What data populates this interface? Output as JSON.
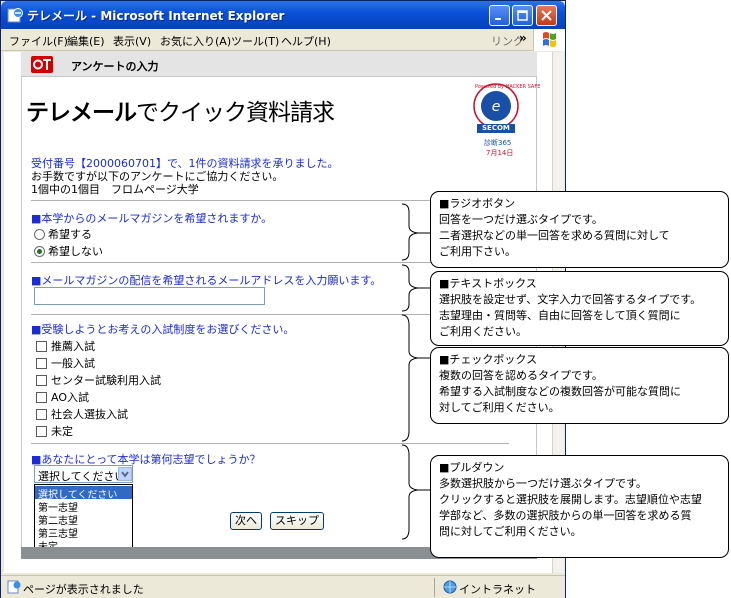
{
  "window": {
    "title": "テレメール - Microsoft Internet Explorer",
    "menu": [
      "ファイル(F)",
      "編集(E)",
      "表示(V)",
      "お気に入り(A)",
      "ツール(T)",
      "ヘルプ(H)"
    ],
    "links_label": "リンク",
    "links_chevron": "»",
    "status_text": "ページが表示されました",
    "zone_text": "イントラネット"
  },
  "page": {
    "header_title": "アンケートの入力",
    "brand_bold": "テレメール",
    "brand_rest": "でクイック資料請求",
    "seal": {
      "top_text": "Powered by HACKER SAFE",
      "middle_text": "SECOM",
      "bottom_text": "診断365",
      "date_text": "7月14日"
    },
    "intro_line1": "受付番号【2000060701】で、1件の資料請求を承りました。",
    "intro_line2": "お手数ですが以下のアンケートにご協力ください。",
    "intro_line3": "1個中の1個目　フロムページ大学",
    "q1": {
      "label": "■本学からのメールマガジンを希望されますか。",
      "options": [
        "希望する",
        "希望しない"
      ],
      "selected_index": 1
    },
    "q2": {
      "label": "■メールマガジンの配信を希望されるメールアドレスを入力願います。",
      "value": ""
    },
    "q3": {
      "label": "■受験しようとお考えの入試制度をお選びください。",
      "options": [
        "推薦入試",
        "一般入試",
        "センター試験利用入試",
        "AO入試",
        "社会人選抜入試",
        "未定"
      ]
    },
    "q4": {
      "label": "■あなたにとって本学は第何志望でしょうか？",
      "selected": "選択してください",
      "options": [
        "選択してください",
        "第一志望",
        "第二志望",
        "第三志望",
        "未定"
      ]
    },
    "buttons": {
      "next": "次へ",
      "skip": "スキップ"
    }
  },
  "callouts": [
    {
      "title": "■ラジオボタン",
      "lines": [
        "回答を一つだけ選ぶタイプです。",
        "二者選択などの単一回答を求める質問に対して",
        "ご利用下さい。"
      ]
    },
    {
      "title": "■テキストボックス",
      "lines": [
        "選択肢を設定せず、文字入力で回答するタイプです。",
        "志望理由・質問等、自由に回答をして頂く質問に",
        "ご利用ください。"
      ]
    },
    {
      "title": "■チェックボックス",
      "lines": [
        "複数の回答を認めるタイプです。",
        "希望する入試制度などの複数回答が可能な質問に",
        "対してご利用ください。"
      ]
    },
    {
      "title": "■プルダウン",
      "lines": [
        "多数選択肢から一つだけ選ぶタイプです。",
        "クリックすると選択肢を展開します。志望順位や志望",
        "学部など、多数の選択肢からの単一回答を求める質",
        "問に対してご利用ください。"
      ]
    }
  ],
  "colors": {
    "title_bar": "#0a52d8",
    "question_blue": "#1b2bd8",
    "brand_red": "#d40000",
    "selection": "#316ac5"
  }
}
